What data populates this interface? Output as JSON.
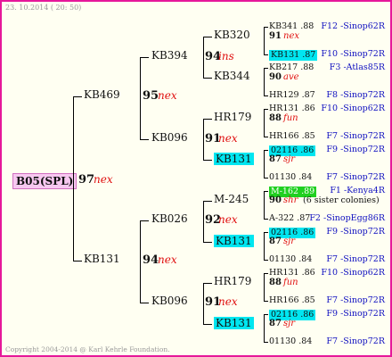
{
  "header": "23. 10.2014 ( 20: 50)",
  "footer": "Copyright 2004-2014 @ Karl Kehrle Foundation.",
  "root": {
    "name": "B05(SPL)",
    "year": "97",
    "tag": "nex"
  },
  "gen1": [
    {
      "name": "KB469",
      "year": "95",
      "tag": "nex"
    },
    {
      "name": "KB131",
      "year": "94",
      "tag": "nex"
    }
  ],
  "gen2": [
    {
      "name": "KB394",
      "year": "94",
      "tag": "ins"
    },
    {
      "name": "KB096",
      "year": "91",
      "tag": "nex"
    },
    {
      "name": "KB026",
      "year": "92",
      "tag": "nex"
    },
    {
      "name": "KB096",
      "year": "91",
      "tag": "nex"
    }
  ],
  "gen3": [
    {
      "name": "KB320"
    },
    {
      "name": "KB344"
    },
    {
      "name": "HR179"
    },
    {
      "name": "KB131"
    },
    {
      "name": "M-245"
    },
    {
      "name": "KB131"
    },
    {
      "name": "HR179"
    },
    {
      "name": "KB131"
    }
  ],
  "gen4": [
    {
      "top": "KB341 .88",
      "top_loc": "F12 -Sinop62R",
      "mid_year": "91",
      "mid_tag": "nex",
      "mid_extra": "",
      "bot": "KB131 .87",
      "bot_loc": "F10 -Sinop72R"
    },
    {
      "top": "KB217 .88",
      "top_loc": "F3 -Atlas85R",
      "mid_year": "90",
      "mid_tag": "ave",
      "mid_extra": "",
      "bot": "HR129 .87",
      "bot_loc": "F8 -Sinop72R"
    },
    {
      "top": "HR131 .86",
      "top_loc": "F10 -Sinop62R",
      "mid_year": "88",
      "mid_tag": "fun",
      "mid_extra": "",
      "bot": "HR166 .85",
      "bot_loc": "F7 -Sinop72R"
    },
    {
      "top": "02116 .86",
      "top_loc": "F9 -Sinop72R",
      "mid_year": "87",
      "mid_tag": "sjr",
      "mid_extra": "",
      "bot": "01130 .84",
      "bot_loc": "F7 -Sinop72R"
    },
    {
      "top": "M-162 .89",
      "top_loc": "F1 -Kenya4R",
      "mid_year": "90",
      "mid_tag": "shr",
      "mid_extra": "(6 sister colonies)",
      "bot": "A-322 .87",
      "bot_loc": "F2 -SinopEgg86R"
    },
    {
      "top": "02116 .86",
      "top_loc": "F9 -Sinop72R",
      "mid_year": "87",
      "mid_tag": "sjr",
      "mid_extra": "",
      "bot": "01130 .84",
      "bot_loc": "F7 -Sinop72R"
    },
    {
      "top": "HR131 .86",
      "top_loc": "F10 -Sinop62R",
      "mid_year": "88",
      "mid_tag": "fun",
      "mid_extra": "",
      "bot": "HR166 .85",
      "bot_loc": "F7 -Sinop72R"
    },
    {
      "top": "02116 .86",
      "top_loc": "F9 -Sinop72R",
      "mid_year": "87",
      "mid_tag": "sjr",
      "mid_extra": "",
      "bot": "01130 .84",
      "bot_loc": "F7 -Sinop72R"
    }
  ],
  "colors": {
    "frame": "#e6189a",
    "highlight_cyan": "#00e6f0",
    "highlight_green": "#20d020",
    "highlight_pink": "#f7c8f0",
    "tag_red": "#e01010",
    "location_blue": "#1010c0"
  }
}
